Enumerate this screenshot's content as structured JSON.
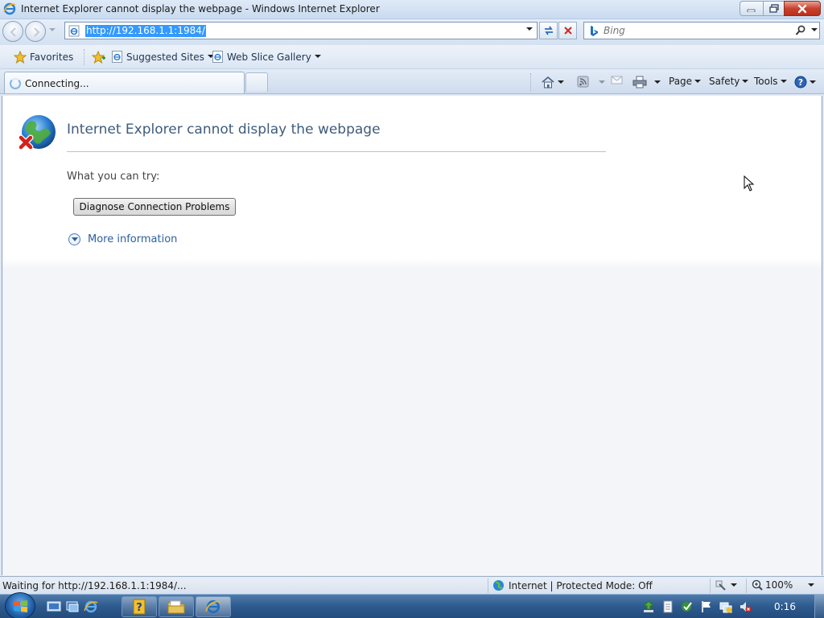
{
  "window": {
    "title": "Internet Explorer cannot display the webpage - Windows Internet Explorer"
  },
  "nav": {
    "url": "http://192.168.1.1:1984/",
    "search_placeholder": "Bing"
  },
  "favorites_bar": {
    "favorites": "Favorites",
    "suggested_sites": "Suggested Sites",
    "web_slice_gallery": "Web Slice Gallery"
  },
  "tab": {
    "label": "Connecting..."
  },
  "commands": {
    "page": "Page",
    "safety": "Safety",
    "tools": "Tools"
  },
  "content": {
    "heading": "Internet Explorer cannot display the webpage",
    "try_label": "What you can try:",
    "diagnose_button": "Diagnose Connection Problems",
    "more_info": "More information"
  },
  "statusbar": {
    "status": "Waiting for http://192.168.1.1:1984/...",
    "zone": "Internet | Protected Mode: Off",
    "zoom": "100%"
  },
  "taskbar": {
    "clock": "0:16"
  },
  "colors": {
    "accent": "#3399ff",
    "heading": "#3f5c7a",
    "link": "#2c5f9e",
    "close_button": "#c8422f"
  },
  "icons": [
    "ie-icon",
    "back-icon",
    "forward-icon",
    "refresh-icon",
    "stop-icon",
    "bing-icon",
    "search-icon",
    "favorites-star-icon",
    "add-favorites-icon",
    "home-icon",
    "feeds-icon",
    "mail-icon",
    "print-icon",
    "help-icon",
    "globe-error-icon",
    "expand-icon",
    "cursor-icon",
    "windows-start-icon"
  ]
}
